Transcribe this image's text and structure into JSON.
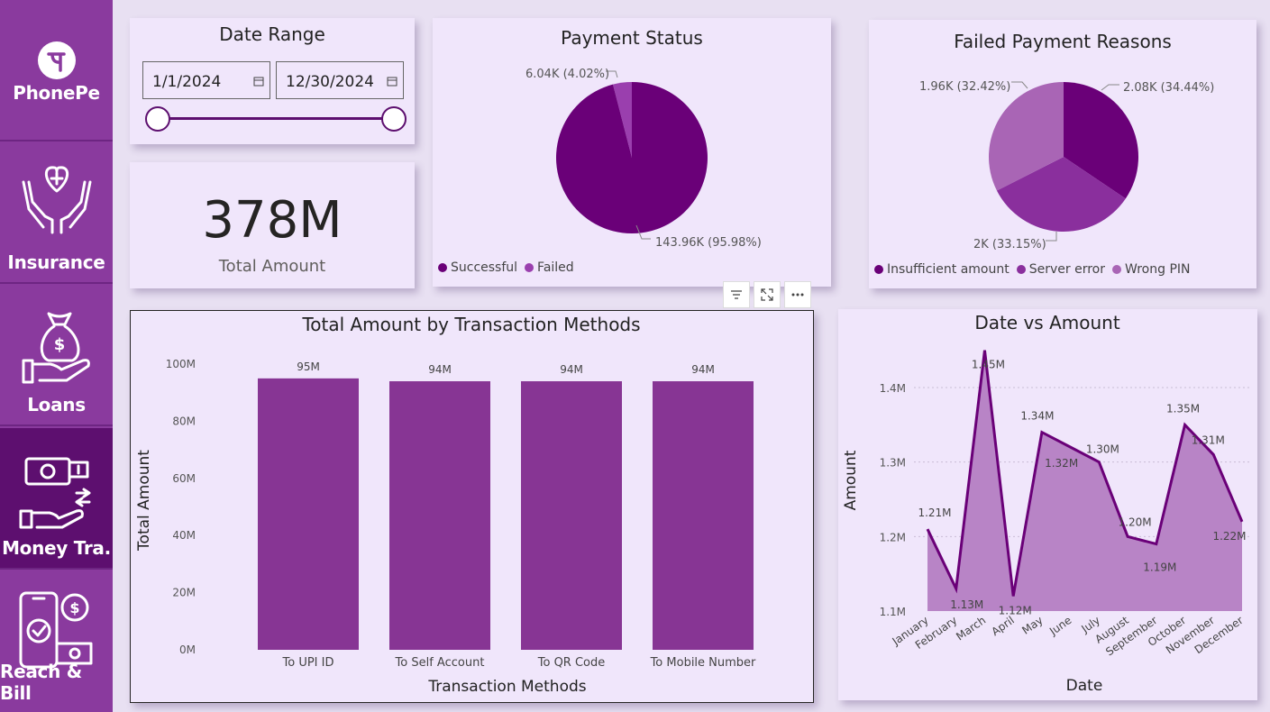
{
  "sidebar": {
    "logo_label": "PhonePe",
    "items": [
      {
        "label": "Insurance",
        "icon": "heart-hands-icon",
        "active": false
      },
      {
        "label": "Loans",
        "icon": "money-bag-hand-icon",
        "active": false
      },
      {
        "label": "Money Tra.",
        "icon": "money-transfer-icon",
        "active": true
      },
      {
        "label": "Reach & Bill",
        "icon": "phone-bill-icon",
        "active": false
      }
    ]
  },
  "date_range": {
    "title": "Date Range",
    "start": "1/1/2024",
    "end": "12/30/2024"
  },
  "kpi": {
    "value": "378M",
    "label": "Total Amount"
  },
  "payment_status": {
    "title": "Payment Status",
    "label_failed": "6.04K (4.02%)",
    "label_success": "143.96K (95.98%)",
    "legend": [
      "Successful",
      "Failed"
    ]
  },
  "failed_reasons": {
    "title": "Failed Payment Reasons",
    "label_insufficient": "2.08K (34.44%)",
    "label_server": "2K (33.15%)",
    "label_pin": "1.96K (32.42%)",
    "legend": [
      "Insufficient amount",
      "Server error",
      "Wrong PIN"
    ]
  },
  "colors": {
    "dark_purple": "#6a0078",
    "mid_purple": "#8a2f9d",
    "light_purple": "#a965b5",
    "bar": "#873594",
    "area": "#b884c6",
    "sidebar": "#8a3a9e",
    "sidebar_active": "#5d0f6f"
  },
  "chart_data": [
    {
      "type": "pie",
      "title": "Payment Status",
      "labels": [
        "Successful",
        "Failed"
      ],
      "values": [
        143960,
        6040
      ],
      "percentages": [
        95.98,
        4.02
      ]
    },
    {
      "type": "pie",
      "title": "Failed Payment Reasons",
      "labels": [
        "Insufficient amount",
        "Server error",
        "Wrong PIN"
      ],
      "values": [
        2080,
        2000,
        1960
      ],
      "percentages": [
        34.44,
        33.15,
        32.42
      ]
    },
    {
      "type": "bar",
      "title": "Total Amount by Transaction Methods",
      "categories": [
        "To UPI ID",
        "To Self Account",
        "To QR Code",
        "To Mobile Number"
      ],
      "values": [
        95,
        94,
        94,
        94
      ],
      "data_labels": [
        "95M",
        "94M",
        "94M",
        "94M"
      ],
      "xlabel": "Transaction Methods",
      "ylabel": "Total Amount",
      "ylim": [
        0,
        100
      ],
      "yticks": [
        "0M",
        "20M",
        "40M",
        "60M",
        "80M",
        "100M"
      ],
      "grid": false
    },
    {
      "type": "area",
      "title": "Date vs Amount",
      "categories": [
        "January",
        "February",
        "March",
        "April",
        "May",
        "June",
        "July",
        "August",
        "September",
        "October",
        "November",
        "December"
      ],
      "values": [
        1.21,
        1.13,
        1.45,
        1.12,
        1.34,
        1.32,
        1.3,
        1.2,
        1.19,
        1.35,
        1.31,
        1.22
      ],
      "data_labels": [
        "1.21M",
        "1.13M",
        "1.45M",
        "1.12M",
        "1.34M",
        "1.32M",
        "1.30M",
        "1.20M",
        "1.19M",
        "1.35M",
        "1.31M",
        "1.22M"
      ],
      "xlabel": "Date",
      "ylabel": "Amount",
      "ylim": [
        1.1,
        1.4
      ],
      "yticks": [
        "1.1M",
        "1.2M",
        "1.3M",
        "1.4M"
      ],
      "grid": true
    }
  ]
}
